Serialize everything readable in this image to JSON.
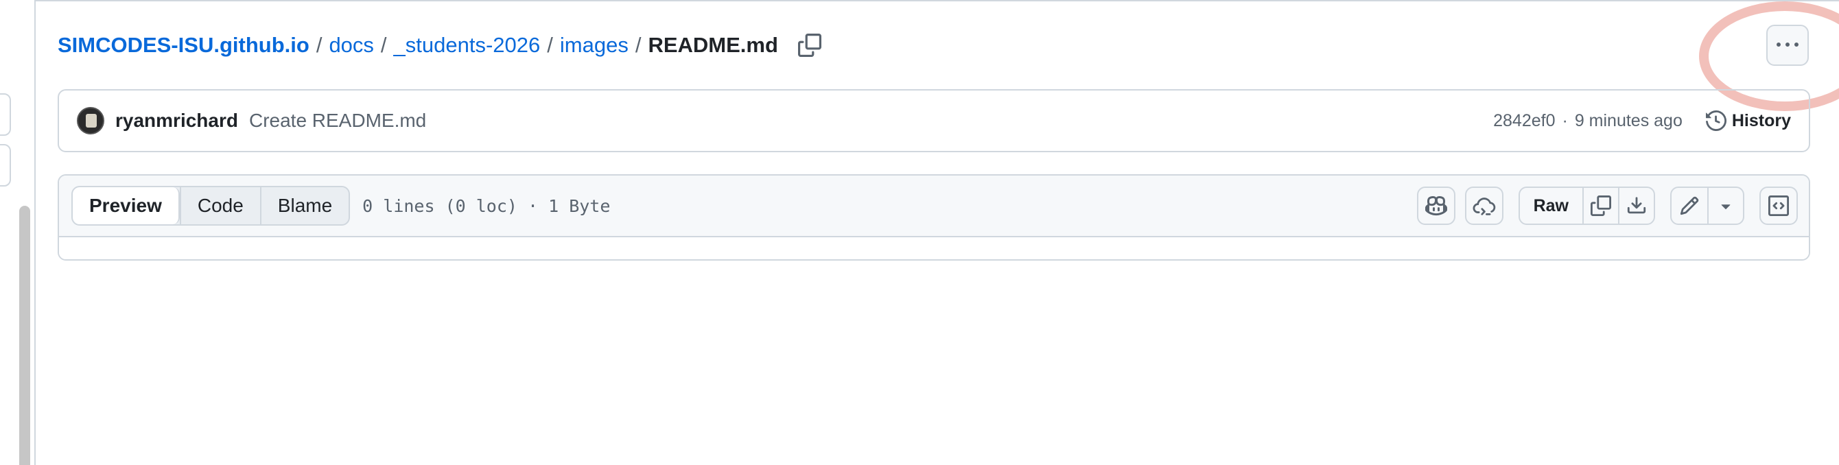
{
  "breadcrumb": {
    "repo": "SIMCODES-ISU.github.io",
    "items": [
      "docs",
      "_students-2026",
      "images"
    ],
    "separator": "/",
    "current": "README.md"
  },
  "commit": {
    "author": "ryanmrichard",
    "message": "Create README.md",
    "sha": "2842ef0",
    "separator": "·",
    "time": "9 minutes ago",
    "history_label": "History"
  },
  "file": {
    "tabs": [
      "Preview",
      "Code",
      "Blame"
    ],
    "active_tab": "Preview",
    "info": "0 lines (0 loc) · 1 Byte",
    "raw_label": "Raw"
  },
  "icons": {
    "copy": "copy-icon",
    "more": "kebab-horizontal-icon",
    "history": "history-icon",
    "copilot": "copilot-icon",
    "codespaces": "cloud-sync-icon",
    "download": "download-icon",
    "edit": "pencil-icon",
    "dropdown": "triangle-down-icon",
    "symbols": "code-square-icon"
  },
  "colors": {
    "link": "#0969da",
    "text": "#1f2328",
    "muted": "#59636e",
    "border": "#d0d7de",
    "highlight": "#e88c82"
  }
}
